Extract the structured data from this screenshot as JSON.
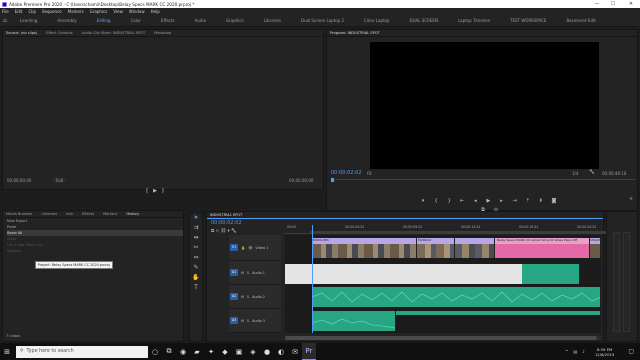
{
  "window": {
    "title": "Adobe Premiere Pro 2020 - C:\\Users\\chamil\\Desktop\\Belay Specs MARK CC 2020.prproj *",
    "controls": {
      "minimize": "—",
      "maximize": "☐",
      "close": "✕"
    }
  },
  "menu": [
    "File",
    "Edit",
    "Clip",
    "Sequence",
    "Markers",
    "Graphics",
    "View",
    "Window",
    "Help"
  ],
  "workspaces": {
    "home_icon": "home-icon",
    "items": [
      {
        "label": "Learning",
        "active": false
      },
      {
        "label": "Assembly",
        "active": false
      },
      {
        "label": "Editing",
        "active": true
      },
      {
        "label": "Color",
        "active": false
      },
      {
        "label": "Effects",
        "active": false
      },
      {
        "label": "Audio",
        "active": false
      },
      {
        "label": "Graphics",
        "active": false
      },
      {
        "label": "Libraries",
        "active": false
      },
      {
        "label": "Dual Screen Laptop 2",
        "active": false
      },
      {
        "label": "Color Laptop",
        "active": false
      },
      {
        "label": "DUAL SCREEN",
        "active": false
      },
      {
        "label": "Laptop Timeline",
        "active": false
      },
      {
        "label": "TEST WORKSPACE",
        "active": false
      },
      {
        "label": "Basement Edit",
        "active": false
      }
    ]
  },
  "source_panel": {
    "tabs": [
      "Source: (no clips)",
      "Effect Controls",
      "Audio Clip Mixer: INDUSTRIAL SPOT",
      "Metadata"
    ],
    "timecode_left": "00;00;00;00",
    "fit": "Full",
    "timecode_right": "00;00;00;00"
  },
  "program_panel": {
    "tab": "Program: INDUSTRIAL SPOT",
    "timecode_left": "00:00:02:02",
    "fit": "Fit",
    "resolution": "1/4",
    "timecode_right": "00:00:48:18"
  },
  "project_panel": {
    "tabs": [
      "Media Browser",
      "Libraries",
      "Info",
      "Effects",
      "Markers",
      "History"
    ],
    "history": [
      "New Export",
      "Paste",
      "Razor All",
      "Clear",
      "Lift in Seq: Work ins...",
      "Replace"
    ],
    "tooltip": "Project: Belay Specs MARK CC 2020.prproj",
    "footer": "7 Undos"
  },
  "timeline": {
    "sequence": "INDUSTRIAL SPOT",
    "timecode": "00:00:02:02",
    "ruler": [
      "00:00",
      "00:00:04:22",
      "00:00:09:22",
      "00:00:14:22",
      "00:00:19:22",
      "00:00:24:22"
    ],
    "tracks": [
      {
        "id": "V1",
        "name": "Video 1"
      },
      {
        "id": "A1",
        "name": "Audio 1"
      },
      {
        "id": "A2",
        "name": "Audio 2"
      },
      {
        "id": "A3",
        "name": "Audio 3"
      }
    ],
    "clips": [
      "RUN1.MP4",
      "MVI0022",
      "Belay Specs MARK CC Linked Song 00 Glass Piano.tiff",
      "SHAKE"
    ]
  },
  "taskbar": {
    "search_placeholder": "Type here to search",
    "time": "8:39 PM",
    "date": "12/6/2019"
  },
  "colors": {
    "accent": "#4e9ff5",
    "video_clip": "#b8a6e6",
    "pink_clip": "#e8a0c8",
    "audio_clip": "#27a683",
    "ws_active": "#6aa1ff"
  }
}
